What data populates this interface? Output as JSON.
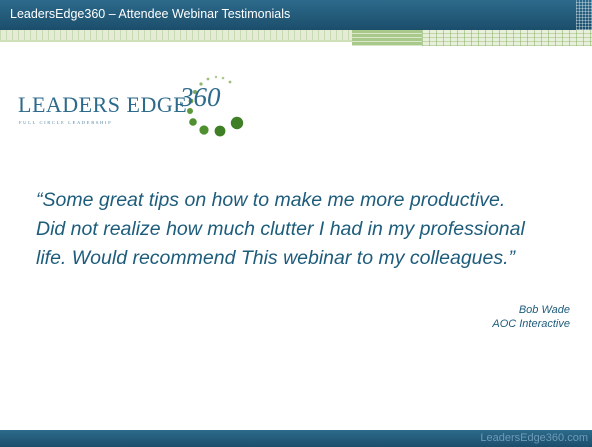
{
  "header": {
    "title": "LeadersEdge360 – Attendee Webinar Testimonials"
  },
  "logo": {
    "wordmark": "LEADERS EDGE",
    "tagline": "FULL CIRCLE LEADERSHIP",
    "number": "360",
    "colors": {
      "text": "#2d6a8b",
      "dots": "#5c9a3a"
    }
  },
  "testimonial": {
    "lines": [
      "“Some great tips on how to make me more productive.",
      "Did not realize how much clutter I had in my professional",
      "life. Would recommend This webinar to my colleagues.”"
    ],
    "author": "Bob Wade",
    "company": "AOC Interactive"
  },
  "footer": {
    "url": "LeadersEdge360.com"
  },
  "colors": {
    "band": "#1f5574",
    "accent_green": "#a9c98a",
    "quote_text": "#1e5c7c"
  }
}
